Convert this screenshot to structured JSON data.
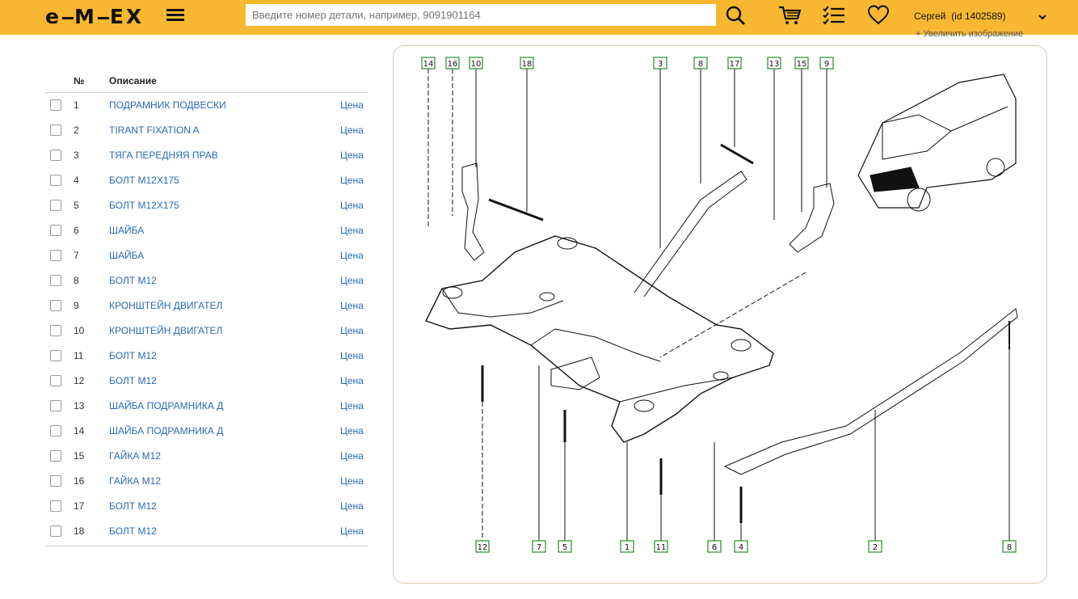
{
  "header": {
    "logo_text": "emex",
    "search_placeholder": "Введите номер детали, например, 9091901164",
    "user_name": "Сергей",
    "user_id": "(id 1402589)",
    "accent_color": "#f7b731"
  },
  "zoom_link": "+ Увеличить изображение",
  "table": {
    "col_num": "№",
    "col_desc": "Описание",
    "price_label": "Цена",
    "rows": [
      {
        "n": "1",
        "d": "ПОДРАМНИК ПОДВЕСКИ"
      },
      {
        "n": "2",
        "d": "TIRANT FIXATION A"
      },
      {
        "n": "3",
        "d": "ТЯГА ПЕРЕДНЯЯ ПРАВ"
      },
      {
        "n": "4",
        "d": "БОЛТ M12X175"
      },
      {
        "n": "5",
        "d": "БОЛТ M12X175"
      },
      {
        "n": "6",
        "d": "ШАЙБА"
      },
      {
        "n": "7",
        "d": "ШАЙБА"
      },
      {
        "n": "8",
        "d": "БОЛТ M12"
      },
      {
        "n": "9",
        "d": "КРОНШТЕЙН ДВИГАТЕЛ"
      },
      {
        "n": "10",
        "d": "КРОНШТЕЙН ДВИГАТЕЛ"
      },
      {
        "n": "11",
        "d": "БОЛТ M12"
      },
      {
        "n": "12",
        "d": "БОЛТ M12"
      },
      {
        "n": "13",
        "d": "ШАЙБА ПОДРАМНИКА Д"
      },
      {
        "n": "14",
        "d": "ШАЙБА ПОДРАМНИКА Д"
      },
      {
        "n": "15",
        "d": "ГАЙКА M12"
      },
      {
        "n": "16",
        "d": "ГАЙКА M12"
      },
      {
        "n": "17",
        "d": "БОЛТ M12"
      },
      {
        "n": "18",
        "d": "БОЛТ M12"
      }
    ]
  },
  "diagram": {
    "top_labels": [
      "14",
      "16",
      "10",
      "18",
      "3",
      "8",
      "17",
      "13",
      "15",
      "9"
    ],
    "bottom_labels": [
      "12",
      "7",
      "5",
      "1",
      "11",
      "6",
      "4",
      "2",
      "8"
    ]
  }
}
